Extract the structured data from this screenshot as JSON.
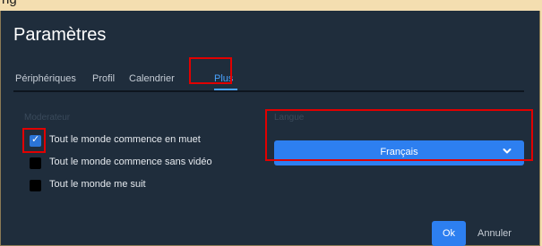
{
  "top_fragment": "ng",
  "dialog": {
    "title": "Paramètres",
    "tabs": [
      {
        "label": "Périphériques"
      },
      {
        "label": "Profil"
      },
      {
        "label": "Calendrier"
      },
      {
        "label": "Plus",
        "active": true
      }
    ],
    "moderator": {
      "label": "Moderateur",
      "options": [
        {
          "label": "Tout le monde commence en muet",
          "checked": true
        },
        {
          "label": "Tout le monde commence sans vidéo",
          "checked": false
        },
        {
          "label": "Tout le monde me suit",
          "checked": false
        }
      ]
    },
    "language": {
      "label": "Langue",
      "selected": "Français"
    },
    "buttons": {
      "ok": "Ok",
      "cancel": "Annuler"
    }
  },
  "colors": {
    "dialog_bg": "#1f2d3c",
    "accent": "#2d7ff0",
    "tab_active": "#4aa3ff",
    "highlight": "#e10000"
  }
}
